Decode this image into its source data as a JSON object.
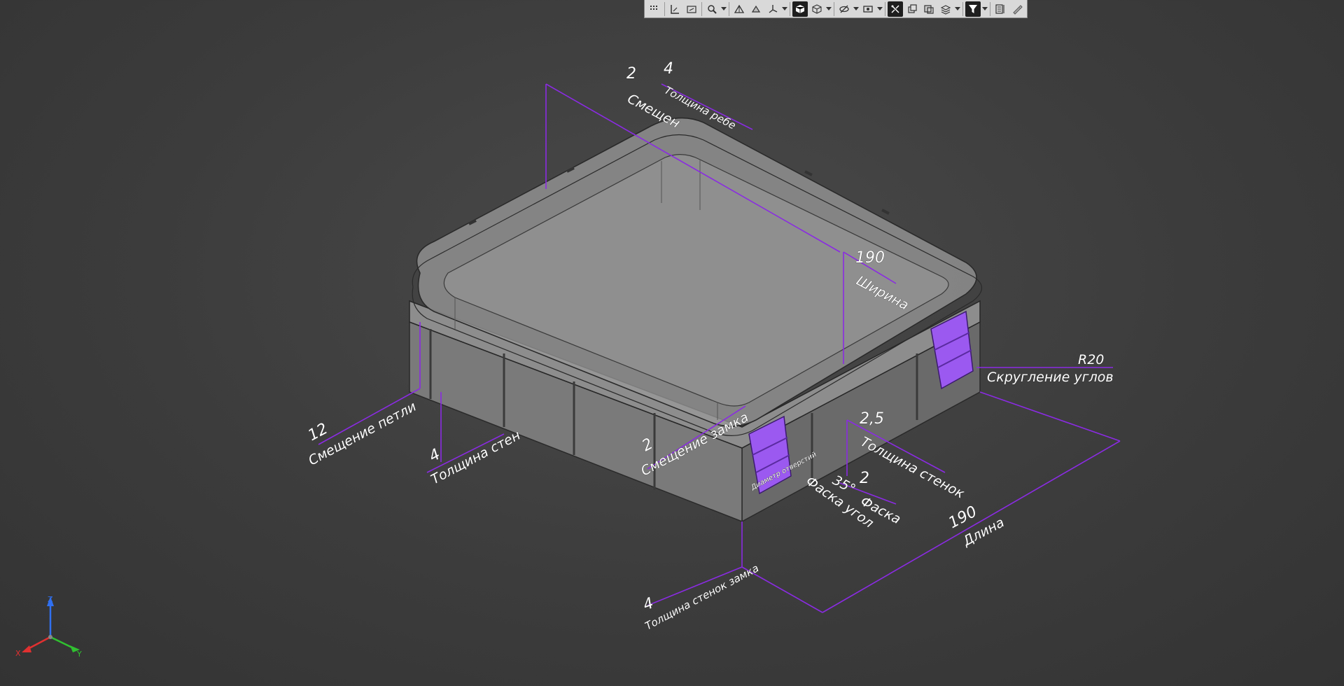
{
  "toolbar": {
    "buttons": [
      "grid-icon",
      "dimension-icon",
      "measure-icon",
      "zoom-icon",
      "dropdown",
      "view-front-icon",
      "view-orient-icon",
      "axes-icon",
      "dropdown",
      "shaded-view-icon",
      "wireframe-view-icon",
      "dropdown",
      "hide-icon",
      "visibility-icon",
      "dropdown",
      "section-icon",
      "copy-icon",
      "parts-icon",
      "layers-icon",
      "dropdown",
      "filter-icon",
      "dropdown",
      "properties-icon",
      "pick-icon"
    ]
  },
  "dimensions": {
    "hinge_offset": {
      "value": "12",
      "label": "Смещение петли"
    },
    "wall_thickness_left": {
      "value": "4",
      "label": "Толщина стен"
    },
    "top_offset": {
      "value": "2",
      "label": "Смещен"
    },
    "rib_thickness": {
      "value": "4",
      "label": "Толщина ребе"
    },
    "width": {
      "value": "190",
      "label": "Ширина"
    },
    "corner_radius": {
      "value": "R20",
      "label": "Скругление углов"
    },
    "wall_thickness": {
      "value": "2,5",
      "label": "Толщина стенок"
    },
    "lock_offset": {
      "value": "2",
      "label": "Смещение замка"
    },
    "chamfer_angle": {
      "value": "35°",
      "label": "Фаска угол"
    },
    "chamfer": {
      "value": "2",
      "label": "Фаска"
    },
    "length": {
      "value": "190",
      "label": "Длина"
    },
    "lock_wall_thickness": {
      "value": "4",
      "label": "Толщина стенок замка"
    },
    "latch_label": "Диаметр отверстий"
  },
  "axes": {
    "z": "Z",
    "x": "X",
    "y": "Y"
  },
  "colors": {
    "background": "#3c3c3c",
    "dimension_line": "#8a2be2",
    "latch": "#9b59f0",
    "model": "#8a8a8a",
    "axis_x": "#e03030",
    "axis_y": "#30c030",
    "axis_z": "#3070f0"
  }
}
